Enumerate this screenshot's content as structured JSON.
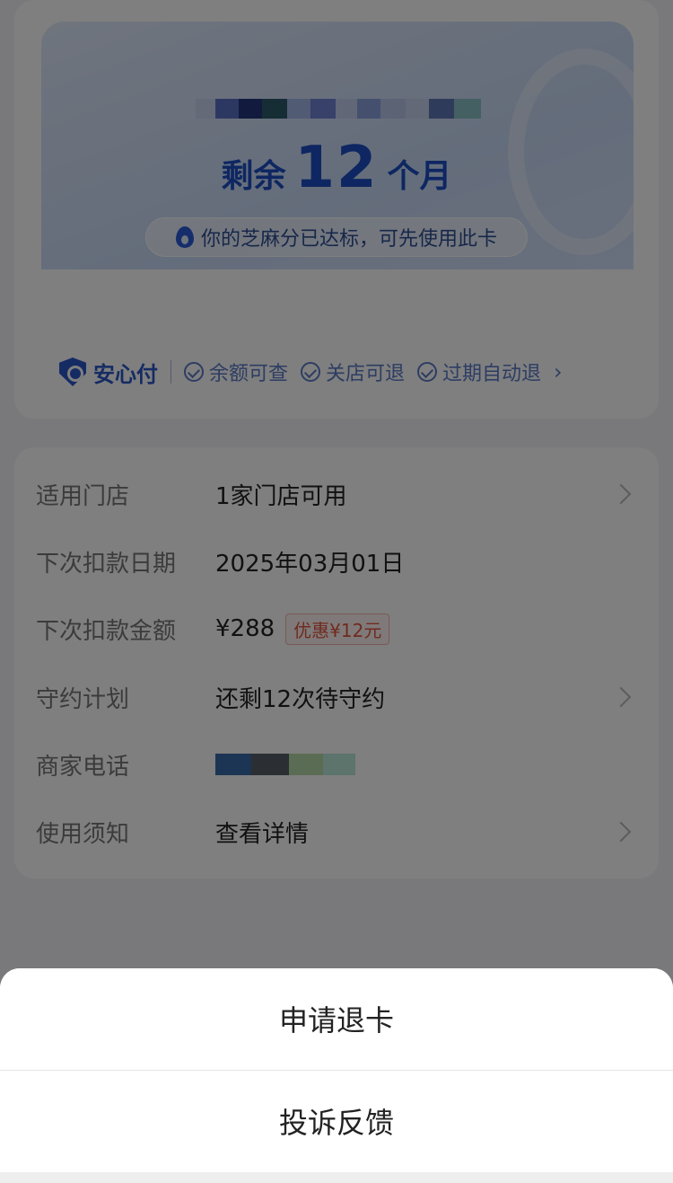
{
  "card": {
    "remaining_prefix": "剩余",
    "remaining_count": "12",
    "remaining_suffix": "个月",
    "credit_notice": "你的芝麻分已达标，可先使用此卡",
    "assurance": {
      "brand": "安心付",
      "items": [
        "余额可查",
        "关店可退",
        "过期自动退"
      ]
    }
  },
  "details": {
    "rows": [
      {
        "label": "适用门店",
        "value": "1家门店可用"
      },
      {
        "label": "下次扣款日期",
        "value": "2025年03月01日"
      },
      {
        "label": "下次扣款金额",
        "value": "¥288",
        "tag": "优惠¥12元"
      },
      {
        "label": "守约计划",
        "value": "还剩12次待守约"
      },
      {
        "label": "商家电话",
        "value": ""
      },
      {
        "label": "使用须知",
        "value": "查看详情"
      }
    ]
  },
  "action_sheet": {
    "options": [
      "申请退卡",
      "投诉反馈"
    ]
  },
  "colors": {
    "accent": "#1d4fc4",
    "promo": "#e0553f"
  }
}
